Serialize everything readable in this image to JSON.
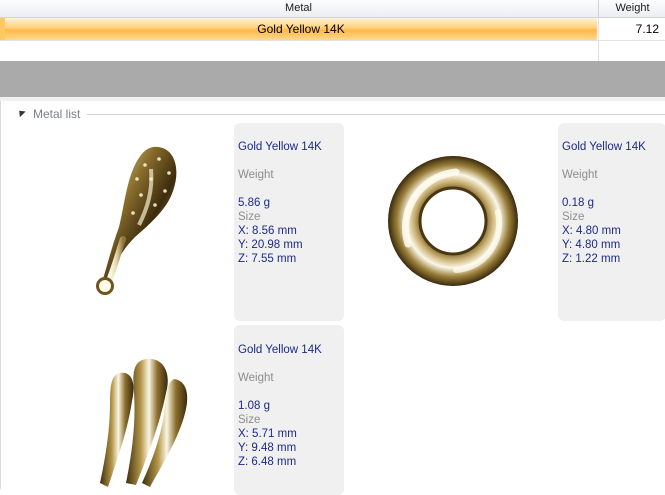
{
  "grid": {
    "columns": {
      "metal": "Metal",
      "weight": "Weight"
    },
    "rows": [
      {
        "metal": "Gold Yellow 14K",
        "weight": "7.12"
      }
    ]
  },
  "metal_list": {
    "title": "Metal list",
    "items": [
      {
        "metal": "Gold Yellow 14K",
        "weight_label": "Weight",
        "weight": "5.86 g",
        "size_label": "Size",
        "x": "X: 8.56 mm",
        "y": "Y: 20.98 mm",
        "z": "Z: 7.55 mm",
        "icon": "pendant-drop-icon"
      },
      {
        "metal": "Gold Yellow 14K",
        "weight_label": "Weight",
        "weight": "0.18 g",
        "size_label": "Size",
        "x": "X: 4.80 mm",
        "y": "Y: 4.80 mm",
        "z": "Z: 1.22 mm",
        "icon": "ring-torus-icon"
      },
      {
        "metal": "Gold Yellow 14K",
        "weight_label": "Weight",
        "weight": "1.08 g",
        "size_label": "Size",
        "x": "X: 5.71 mm",
        "y": "Y: 9.48 mm",
        "z": "Z: 6.48 mm",
        "icon": "cluster-petal-icon"
      }
    ]
  },
  "colors": {
    "selected_row": "#ffc861",
    "splitter": "#aaaaaa",
    "card_bg": "#f0f0f0",
    "value_text": "#1b2a86"
  }
}
